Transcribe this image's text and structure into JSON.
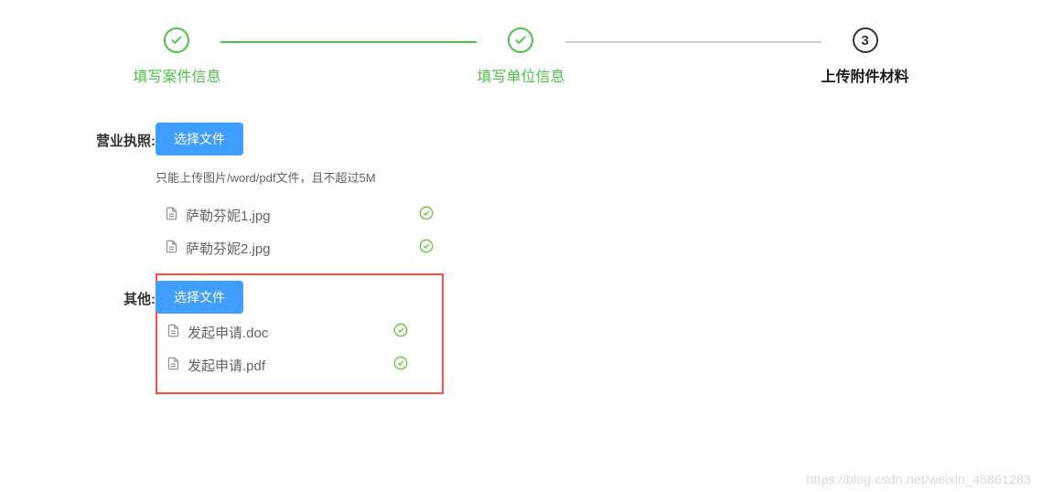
{
  "steps": {
    "s1": {
      "label": "填写案件信息"
    },
    "s2": {
      "label": "填写单位信息"
    },
    "s3": {
      "label": "上传附件材料",
      "num": "3"
    }
  },
  "form": {
    "license": {
      "label": "营业执照:",
      "button": "选择文件",
      "hint": "只能上传图片/word/pdf文件，且不超过5M",
      "files": [
        {
          "name": "萨勒芬妮1.jpg"
        },
        {
          "name": "萨勒芬妮2.jpg"
        }
      ]
    },
    "other": {
      "label": "其他:",
      "button": "选择文件",
      "files": [
        {
          "name": "发起申请.doc"
        },
        {
          "name": "发起申请.pdf"
        }
      ]
    }
  },
  "watermark": "https://blog.csdn.net/weixin_45861283"
}
